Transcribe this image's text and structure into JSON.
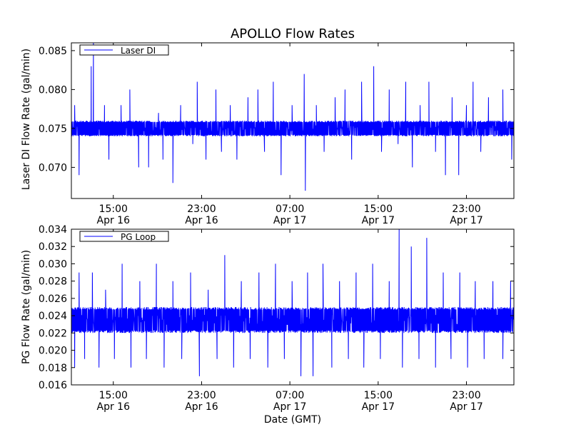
{
  "chart_data": [
    {
      "type": "line",
      "title": "APOLLO Flow Rates",
      "ylabel": "Laser DI Flow Rate (gal/min)",
      "xlabel": "",
      "ylim": [
        0.066,
        0.086
      ],
      "yticks": [
        0.07,
        0.075,
        0.08,
        0.085
      ],
      "ytick_labels": [
        "0.070",
        "0.075",
        "0.080",
        "0.085"
      ],
      "xlim_hours": [
        11.2,
        51.3
      ],
      "xticks": [
        {
          "hour": 15,
          "time": "15:00",
          "date": "Apr 16"
        },
        {
          "hour": 23,
          "time": "23:00",
          "date": "Apr 16"
        },
        {
          "hour": 31,
          "time": "07:00",
          "date": "Apr 17"
        },
        {
          "hour": 39,
          "time": "15:00",
          "date": "Apr 17"
        },
        {
          "hour": 47,
          "time": "23:00",
          "date": "Apr 17"
        }
      ],
      "legend": {
        "placement": "top-left",
        "entries": [
          "Laser DI"
        ]
      },
      "series": [
        {
          "name": "Laser DI",
          "color": "#0000ff",
          "typical_band": [
            0.074,
            0.076
          ],
          "spikes": [
            [
              11.5,
              0.078
            ],
            [
              11.9,
              0.069
            ],
            [
              12.6,
              0.076
            ],
            [
              13.0,
              0.083
            ],
            [
              13.2,
              0.086
            ],
            [
              14.2,
              0.078
            ],
            [
              14.6,
              0.071
            ],
            [
              15.7,
              0.078
            ],
            [
              16.5,
              0.08
            ],
            [
              17.3,
              0.07
            ],
            [
              18.2,
              0.07
            ],
            [
              19.1,
              0.077
            ],
            [
              19.5,
              0.071
            ],
            [
              20.4,
              0.068
            ],
            [
              21.1,
              0.078
            ],
            [
              22.2,
              0.073
            ],
            [
              22.6,
              0.081
            ],
            [
              23.4,
              0.071
            ],
            [
              24.3,
              0.08
            ],
            [
              24.8,
              0.072
            ],
            [
              25.6,
              0.078
            ],
            [
              26.2,
              0.071
            ],
            [
              27.2,
              0.079
            ],
            [
              28.1,
              0.08
            ],
            [
              28.7,
              0.072
            ],
            [
              29.5,
              0.081
            ],
            [
              30.2,
              0.069
            ],
            [
              31.2,
              0.078
            ],
            [
              32.3,
              0.082
            ],
            [
              32.4,
              0.067
            ],
            [
              33.4,
              0.078
            ],
            [
              34.1,
              0.072
            ],
            [
              35.1,
              0.079
            ],
            [
              36.0,
              0.08
            ],
            [
              36.6,
              0.071
            ],
            [
              37.5,
              0.081
            ],
            [
              38.6,
              0.083
            ],
            [
              39.3,
              0.072
            ],
            [
              40.0,
              0.08
            ],
            [
              40.8,
              0.073
            ],
            [
              41.5,
              0.081
            ],
            [
              42.1,
              0.07
            ],
            [
              42.8,
              0.078
            ],
            [
              43.6,
              0.081
            ],
            [
              44.2,
              0.072
            ],
            [
              45.1,
              0.069
            ],
            [
              45.7,
              0.079
            ],
            [
              46.3,
              0.069
            ],
            [
              47.0,
              0.078
            ],
            [
              47.6,
              0.081
            ],
            [
              48.3,
              0.072
            ],
            [
              49.0,
              0.079
            ],
            [
              50.3,
              0.08
            ],
            [
              51.1,
              0.071
            ]
          ]
        }
      ]
    },
    {
      "type": "line",
      "title": "",
      "ylabel": "PG Flow Rate (gal/min)",
      "xlabel": "Date (GMT)",
      "ylim": [
        0.016,
        0.034
      ],
      "yticks": [
        0.016,
        0.018,
        0.02,
        0.022,
        0.024,
        0.026,
        0.028,
        0.03,
        0.032,
        0.034
      ],
      "ytick_labels": [
        "0.016",
        "0.018",
        "0.020",
        "0.022",
        "0.024",
        "0.026",
        "0.028",
        "0.030",
        "0.032",
        "0.034"
      ],
      "xlim_hours": [
        11.2,
        51.3
      ],
      "xticks": [
        {
          "hour": 15,
          "time": "15:00",
          "date": "Apr 16"
        },
        {
          "hour": 23,
          "time": "23:00",
          "date": "Apr 16"
        },
        {
          "hour": 31,
          "time": "07:00",
          "date": "Apr 17"
        },
        {
          "hour": 39,
          "time": "15:00",
          "date": "Apr 17"
        },
        {
          "hour": 47,
          "time": "23:00",
          "date": "Apr 17"
        }
      ],
      "legend": {
        "placement": "top-left",
        "entries": [
          "PG Loop"
        ]
      },
      "series": [
        {
          "name": "PG Loop",
          "color": "#0000ff",
          "typical_band": [
            0.022,
            0.025
          ],
          "spikes": [
            [
              11.5,
              0.018
            ],
            [
              11.9,
              0.029
            ],
            [
              12.4,
              0.019
            ],
            [
              13.1,
              0.029
            ],
            [
              13.7,
              0.018
            ],
            [
              14.3,
              0.027
            ],
            [
              15.1,
              0.019
            ],
            [
              15.8,
              0.03
            ],
            [
              16.6,
              0.018
            ],
            [
              17.4,
              0.028
            ],
            [
              18.0,
              0.019
            ],
            [
              18.9,
              0.03
            ],
            [
              19.6,
              0.018
            ],
            [
              20.4,
              0.028
            ],
            [
              21.2,
              0.019
            ],
            [
              22.0,
              0.029
            ],
            [
              22.8,
              0.017
            ],
            [
              23.6,
              0.027
            ],
            [
              24.4,
              0.019
            ],
            [
              25.1,
              0.031
            ],
            [
              25.9,
              0.018
            ],
            [
              26.6,
              0.028
            ],
            [
              27.4,
              0.019
            ],
            [
              28.2,
              0.029
            ],
            [
              29.0,
              0.018
            ],
            [
              29.7,
              0.03
            ],
            [
              30.5,
              0.019
            ],
            [
              31.2,
              0.028
            ],
            [
              32.0,
              0.017
            ],
            [
              32.6,
              0.029
            ],
            [
              33.1,
              0.017
            ],
            [
              34.0,
              0.03
            ],
            [
              34.8,
              0.018
            ],
            [
              35.5,
              0.028
            ],
            [
              36.3,
              0.019
            ],
            [
              37.0,
              0.029
            ],
            [
              37.7,
              0.018
            ],
            [
              38.5,
              0.03
            ],
            [
              39.2,
              0.019
            ],
            [
              40.0,
              0.028
            ],
            [
              40.9,
              0.034
            ],
            [
              41.2,
              0.018
            ],
            [
              42.0,
              0.032
            ],
            [
              42.7,
              0.019
            ],
            [
              43.4,
              0.033
            ],
            [
              44.2,
              0.018
            ],
            [
              44.9,
              0.029
            ],
            [
              45.6,
              0.019
            ],
            [
              46.4,
              0.029
            ],
            [
              47.1,
              0.018
            ],
            [
              47.8,
              0.028
            ],
            [
              48.6,
              0.019
            ],
            [
              49.4,
              0.028
            ],
            [
              50.3,
              0.019
            ],
            [
              51.0,
              0.028
            ]
          ]
        }
      ]
    }
  ]
}
